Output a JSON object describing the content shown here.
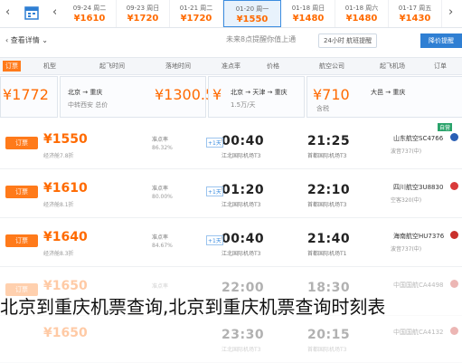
{
  "date_strip": {
    "prev_arrow": "‹",
    "next_arrow": "›",
    "cells": [
      {
        "date": "09-24 周二",
        "price": "¥1610"
      },
      {
        "date": "09-23 周日",
        "price": "¥1720"
      },
      {
        "date": "01-21 周二",
        "price": "¥1720"
      },
      {
        "date": "01-20 周一",
        "price": "¥1550"
      },
      {
        "date": "01-18 周日",
        "price": "¥1480"
      },
      {
        "date": "01-18 周六",
        "price": "¥1480"
      },
      {
        "date": "01-17 周五",
        "price": "¥1430"
      }
    ]
  },
  "bar2": {
    "left_text": "查看详情",
    "mid_text": "未来8点提醒你值上通",
    "mid_highlight": "上通",
    "chip_text": "24小时 航班提醒",
    "blue_button": "降价提醒"
  },
  "filters": {
    "items": [
      "订票",
      "机型",
      "起飞时间",
      "落地时间",
      "准点率",
      "价格",
      "航空公司",
      "起飞机场",
      "订单"
    ]
  },
  "recommend_cards": [
    {
      "price": "¥1772",
      "l1": "",
      "l2": ""
    },
    {
      "price": "¥1300.5",
      "l1": "北京 → 重庆",
      "l2": "中转西安 总价"
    },
    {
      "price": "¥",
      "l1": "北京 → 天津 → 重庆",
      "l2": "1.5万/天"
    },
    {
      "price": "¥710",
      "l1": "大邑 → 重庆",
      "l2": "含税"
    }
  ],
  "flights": [
    {
      "airline": "山东航空SC4766",
      "meta": "波音737(中)",
      "dep": "21:25",
      "dep_apt": "首都国际机场T3",
      "arr": "00:40",
      "arr_apt": "江北国际机场T3",
      "tag": "+1天",
      "ontime": "准点率",
      "ontime2": "86.32%",
      "fare": "¥1550",
      "fare_sub": "经济舱7.8折",
      "book": "订票",
      "flag": "自营"
    },
    {
      "airline": "四川航空3U8830",
      "meta": "空客320(中)",
      "dep": "22:10",
      "dep_apt": "首都国际机场T3",
      "arr": "01:20",
      "arr_apt": "江北国际机场T3",
      "tag": "+1天",
      "ontime": "准点率",
      "ontime2": "80.00%",
      "fare": "¥1610",
      "fare_sub": "经济舱8.1折",
      "book": "订票",
      "flag": ""
    },
    {
      "airline": "海南航空HU7376",
      "meta": "波音737(中)",
      "dep": "21:40",
      "dep_apt": "首都国际机场T1",
      "arr": "00:40",
      "arr_apt": "江北国际机场T3",
      "tag": "+1天",
      "ontime": "准点率",
      "ontime2": "84.67%",
      "fare": "¥1640",
      "fare_sub": "经济舱8.3折",
      "book": "订票",
      "flag": ""
    },
    {
      "airline": "中国国航CA4498",
      "meta": "空客321(中)",
      "dep": "18:30",
      "dep_apt": "首都国际机场T3",
      "arr": "22:00",
      "arr_apt": "江北国际机场T3",
      "tag": "",
      "ontime": "准点率",
      "ontime2": "",
      "fare": "¥1650",
      "fare_sub": "",
      "book": "订票",
      "flag": ""
    },
    {
      "airline": "中国国航CA4132",
      "meta": "",
      "dep": "20:15",
      "dep_apt": "首都国际机场T3",
      "arr": "23:30",
      "arr_apt": "江北国际机场T3",
      "tag": "",
      "ontime": "",
      "ontime2": "",
      "fare": "¥1650",
      "fare_sub": "",
      "book": "",
      "flag": ""
    }
  ],
  "caption": "北京到重庆机票查询,北京到重庆机票查询时刻表"
}
